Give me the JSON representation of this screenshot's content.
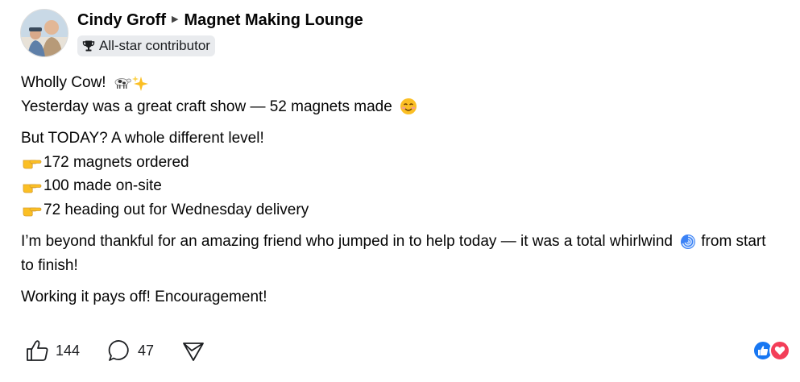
{
  "author": {
    "name": "Cindy Groff",
    "group": "Magnet Making Lounge",
    "badge": "All-star contributor"
  },
  "post": {
    "p1_line1": "Wholly Cow!",
    "p1_line2": "Yesterday was a great craft show — 52 magnets made",
    "p2_line1": "But TODAY? A whole different level!",
    "p2_item1": "172 magnets ordered",
    "p2_item2": "100 made on-site",
    "p2_item3": "72 heading out for Wednesday delivery",
    "p3_before": "I’m beyond thankful for an amazing friend who jumped in to help today — it was a total whirlwind",
    "p3_after": "from start to finish!",
    "p4": "Working it pays off! Encouragement!"
  },
  "actions": {
    "likes": "144",
    "comments": "47"
  },
  "icons": [
    "trophy-icon",
    "cow-emoji",
    "sparkles-emoji",
    "smiling-face-emoji",
    "pointing-hand-emoji",
    "cyclone-emoji",
    "like-icon",
    "comment-icon",
    "share-icon",
    "like-reaction-icon",
    "love-reaction-icon"
  ],
  "colors": {
    "like_blue": "#1877f2",
    "love_red": "#f33e58",
    "badge_bg": "#e9ebee"
  }
}
